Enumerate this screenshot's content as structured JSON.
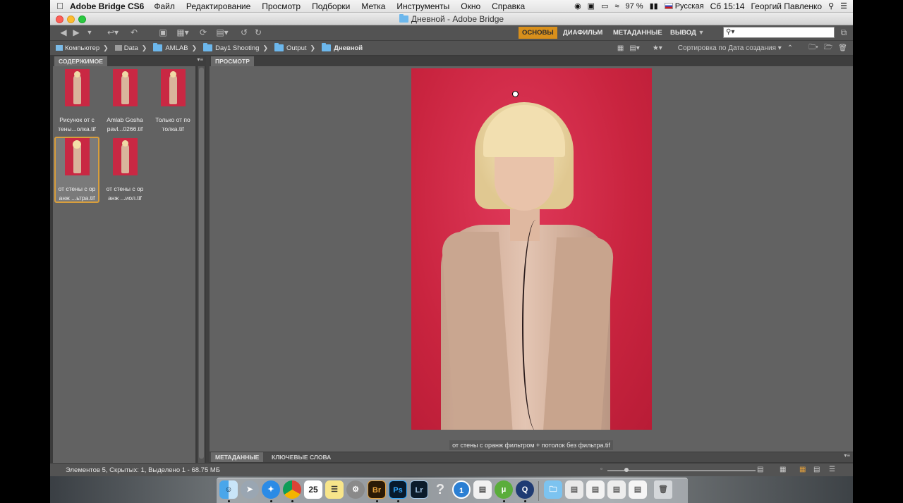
{
  "menubar": {
    "app_name": "Adobe Bridge CS6",
    "items": [
      "Файл",
      "Редактирование",
      "Просмотр",
      "Подборки",
      "Метка",
      "Инструменты",
      "Окно",
      "Справка"
    ],
    "battery": "97 %",
    "input_source": "Русская",
    "clock": "Сб 15:14",
    "user": "Георгий Павленко"
  },
  "window": {
    "title": "Дневной - Adobe Bridge"
  },
  "workspaces": {
    "items": [
      "ОСНОВЫ",
      "ДИАФИЛЬМ",
      "МЕТАДАННЫЕ",
      "ВЫВОД"
    ],
    "active": "ОСНОВЫ"
  },
  "search": {
    "value": ""
  },
  "path": {
    "crumbs": [
      "Компьютер",
      "Data",
      "AMLAB",
      "Day1 Shooting",
      "Output",
      "Дневной"
    ]
  },
  "sort": {
    "label": "Сортировка по Дата создания"
  },
  "content_panel": {
    "tab": "СОДЕРЖИМОЕ",
    "thumbnails": [
      {
        "line1": "Рисунок от с",
        "line2": "тены...олка.tif",
        "selected": false
      },
      {
        "line1": "Amlab Gosha",
        "line2": "pavl...0266.tif",
        "selected": false
      },
      {
        "line1": "Только от по",
        "line2": "толка.tif",
        "selected": false
      },
      {
        "line1": "от стены с ор",
        "line2": "анж ...ьтра.tif",
        "selected": true
      },
      {
        "line1": "от стены с ор",
        "line2": "анж ...иол.tif",
        "selected": false
      }
    ]
  },
  "preview_panel": {
    "tab": "ПРОСМОТР",
    "caption": "от стены с оранж фильтром + потолок без фильтра.tif"
  },
  "bottom_tabs": {
    "metadata": "МЕТАДАННЫЕ",
    "keywords": "КЛЮЧЕВЫЕ СЛОВА"
  },
  "status": {
    "text": "Элементов 5, Скрытых: 1, Выделено 1 - 68.75 МБ",
    "zoom_fraction": 0.12
  },
  "dock": {
    "calendar_day": "25",
    "apps": [
      "Finder",
      "Launchpad",
      "Safari",
      "Chrome",
      "Calendar",
      "Notes",
      "System Preferences",
      "Br",
      "Ps",
      "Lr",
      "Help",
      "1Password",
      "Evernote",
      "uTorrent",
      "QuickTime",
      "Folder",
      "Documents",
      "Documents",
      "Documents",
      "Documents",
      "Trash"
    ]
  },
  "colors": {
    "accent": "#d88f1b",
    "panel": "#626262",
    "background_red": "#c9243f"
  }
}
